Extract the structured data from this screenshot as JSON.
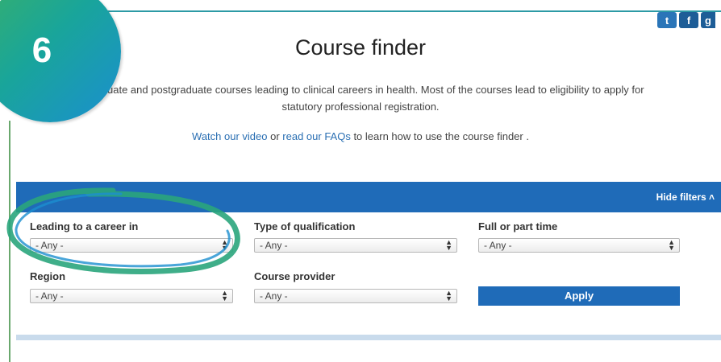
{
  "step": {
    "number": "6"
  },
  "social": {
    "icons": [
      {
        "name": "twitter-icon",
        "glyph": "t"
      },
      {
        "name": "facebook-icon",
        "glyph": "f"
      },
      {
        "name": "googleplus-icon",
        "glyph": "g"
      }
    ]
  },
  "header": {
    "title": "Course finder"
  },
  "intro": {
    "line1": "uate and postgraduate courses leading to clinical careers in health. Most of the courses lead to eligibility to apply for",
    "line2": "statutory professional registration."
  },
  "help": {
    "video_link": "Watch our video",
    "or_text": " or ",
    "faq_link": "read our FAQs",
    "rest_text": " to learn how to use the course finder ."
  },
  "filters": {
    "hide_label": "Hide filters",
    "career": {
      "label": "Leading to a career in",
      "value": "- Any -"
    },
    "qualification": {
      "label": "Type of qualification",
      "value": "- Any -"
    },
    "mode": {
      "label": "Full or part time",
      "value": "- Any -"
    },
    "region": {
      "label": "Region",
      "value": "- Any -"
    },
    "provider": {
      "label": "Course provider",
      "value": "- Any -"
    },
    "apply_label": "Apply"
  },
  "colors": {
    "filter_bar": "#1f6bb8",
    "badge_start": "#38b06a",
    "badge_end": "#1b8fd0",
    "highlight": "#2aa57c"
  }
}
